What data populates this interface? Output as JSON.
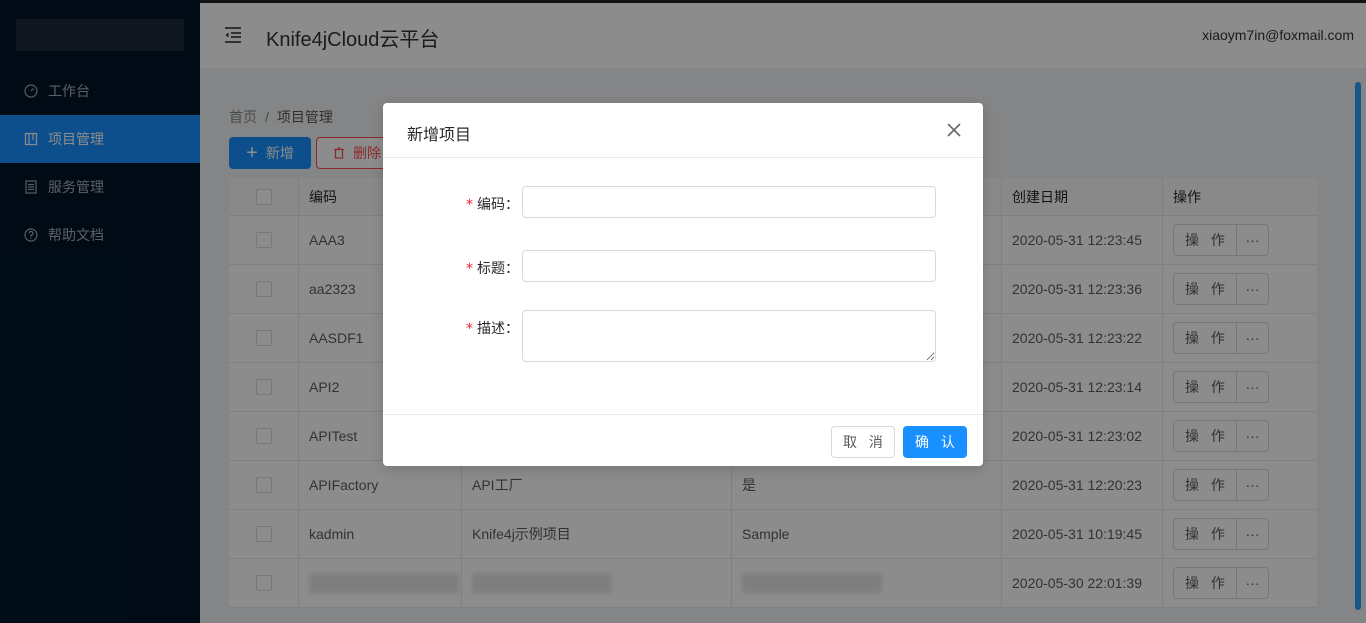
{
  "colors": {
    "primary": "#1890ff",
    "danger": "#ff4d4f",
    "sidebar": "#001529"
  },
  "sidebar": {
    "items": [
      {
        "label": "工作台",
        "icon": "dashboard-icon",
        "active": false
      },
      {
        "label": "项目管理",
        "icon": "project-icon",
        "active": true
      },
      {
        "label": "服务管理",
        "icon": "service-icon",
        "active": false
      },
      {
        "label": "帮助文档",
        "icon": "help-icon",
        "active": false
      }
    ]
  },
  "header": {
    "title": "Knife4jCloud云平台",
    "user_email": "xiaoym7in@foxmail.com"
  },
  "breadcrumb": {
    "home": "首页",
    "separator": "/",
    "current": "项目管理"
  },
  "toolbar": {
    "add_label": "新增",
    "delete_label": "删除"
  },
  "table": {
    "columns": {
      "code": "编码",
      "created": "创建日期",
      "action": "操作"
    },
    "action_label": "操 作",
    "more_label": "···",
    "rows": [
      {
        "code": "AAA3",
        "title": "",
        "desc": "",
        "created": "2020-05-31 12:23:45"
      },
      {
        "code": "aa2323",
        "title": "",
        "desc": "",
        "created": "2020-05-31 12:23:36"
      },
      {
        "code": "AASDF1",
        "title": "",
        "desc": "",
        "created": "2020-05-31 12:23:22"
      },
      {
        "code": "API2",
        "title": "",
        "desc": "",
        "created": "2020-05-31 12:23:14"
      },
      {
        "code": "APITest",
        "title": "",
        "desc": "",
        "created": "2020-05-31 12:23:02"
      },
      {
        "code": "APIFactory",
        "title": "API工厂",
        "desc": "是",
        "created": "2020-05-31 12:20:23"
      },
      {
        "code": "kadmin",
        "title": "Knife4j示例项目",
        "desc": "Sample",
        "created": "2020-05-31 10:19:45"
      },
      {
        "code": "",
        "title": "",
        "desc": "",
        "created": "2020-05-30 22:01:39"
      }
    ]
  },
  "modal": {
    "title": "新增项目",
    "fields": [
      {
        "label": "编码",
        "value": "",
        "placeholder": ""
      },
      {
        "label": "标题",
        "value": "",
        "placeholder": ""
      },
      {
        "label": "描述",
        "value": "",
        "placeholder": ""
      }
    ],
    "required_mark": "*",
    "cancel_label": "取 消",
    "ok_label": "确 认"
  }
}
